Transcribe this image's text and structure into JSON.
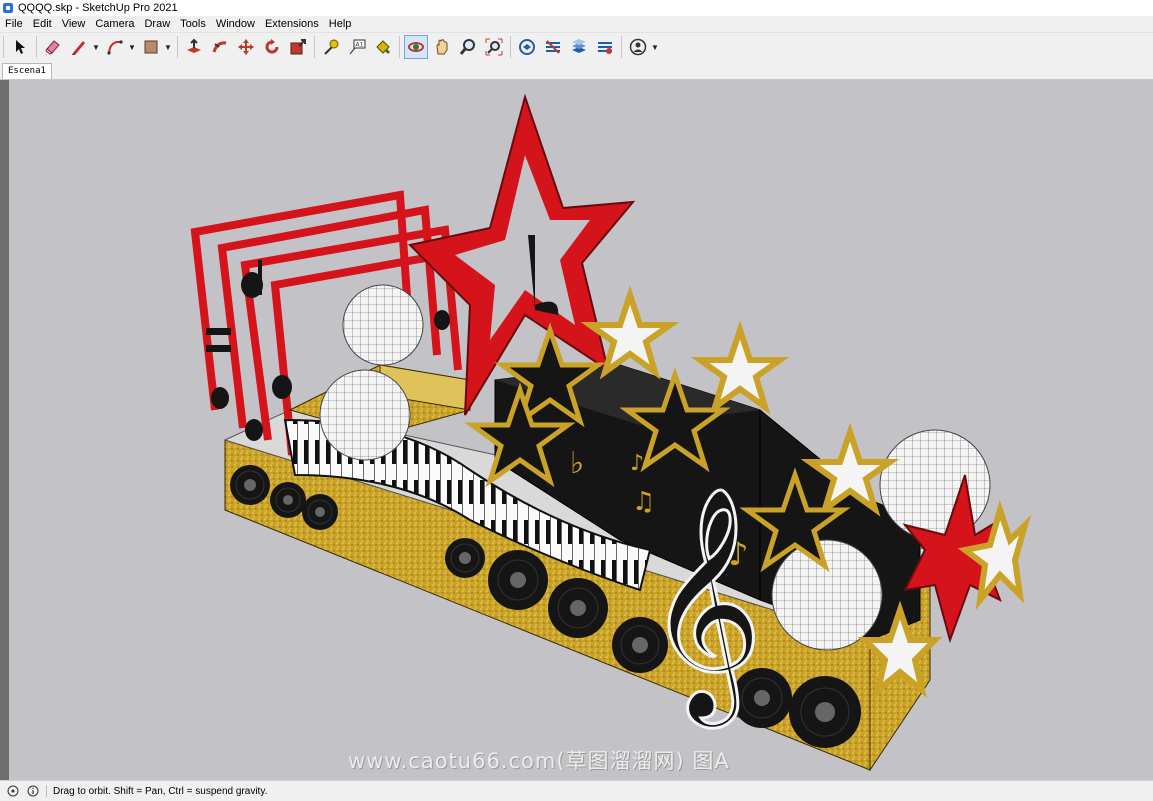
{
  "window": {
    "title": "QQQQ.skp - SketchUp Pro 2021"
  },
  "menu": [
    "File",
    "Edit",
    "View",
    "Camera",
    "Draw",
    "Tools",
    "Window",
    "Extensions",
    "Help"
  ],
  "toolbar": {
    "tools": [
      "select-arrow-icon",
      "eraser-icon",
      "pencil-line-icon",
      "arc-icon",
      "rectangle-icon",
      "push-pull-icon",
      "follow-me-icon",
      "move-icon",
      "rotate-icon",
      "scale-icon",
      "tape-measure-icon",
      "text-label-icon",
      "paint-bucket-icon",
      "orbit-icon",
      "pan-icon",
      "zoom-icon",
      "zoom-extents-icon",
      "3d-warehouse-icon",
      "extension-warehouse-icon",
      "layout-icon",
      "extension-manager-icon",
      "account-icon"
    ],
    "active_tool": "orbit-icon"
  },
  "scene_tab": {
    "label": "Escena1"
  },
  "viewport": {
    "background": "#c3c3c7",
    "watermark": "www.caotu66.com(草图溜溜网) 图A"
  },
  "status": {
    "text": "Drag to orbit. Shift = Pan, Ctrl = suspend gravity."
  },
  "colors": {
    "red": "#d4141a",
    "gold": "#c9a227",
    "black": "#151515",
    "white": "#f4f4f4"
  }
}
